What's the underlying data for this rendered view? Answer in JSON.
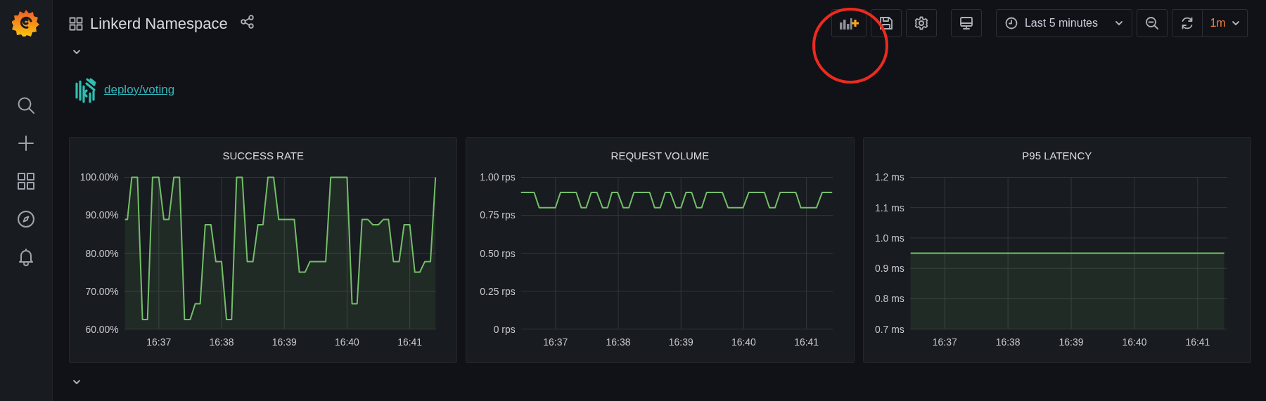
{
  "dashboard": {
    "title": "Linkerd Namespace"
  },
  "toolbar": {
    "time_range": "Last 5 minutes",
    "refresh_interval": "1m"
  },
  "link": {
    "text": "deploy/voting"
  },
  "panels": [
    {
      "chart_data": {
        "type": "area",
        "title": "SUCCESS RATE",
        "x": [
          996.46,
          996.5,
          996.57,
          996.66,
          996.74,
          996.82,
          996.9,
          997,
          997.08,
          997.16,
          997.24,
          997.33,
          997.41,
          997.5,
          997.58,
          997.66,
          997.74,
          997.83,
          997.91,
          998,
          998.08,
          998.16,
          998.24,
          998.33,
          998.41,
          998.5,
          998.58,
          998.66,
          998.74,
          998.83,
          998.91,
          999.16,
          999.24,
          999.33,
          999.41,
          999.66,
          999.74,
          1000,
          1000.08,
          1000.16,
          1000.24,
          1000.33,
          1000.41,
          1000.5,
          1000.58,
          1000.66,
          1000.74,
          1000.83,
          1000.91,
          1001,
          1001.08,
          1001.16,
          1001.24,
          1001.33,
          1001.41
        ],
        "series": [
          {
            "color": "#73bf69",
            "values": [
              88.9,
              88.9,
              100,
              100,
              62.5,
              62.5,
              100,
              100,
              88.9,
              88.9,
              100,
              100,
              62.5,
              62.5,
              66.7,
              66.7,
              87.5,
              87.5,
              77.8,
              77.8,
              62.5,
              62.5,
              100,
              100,
              77.8,
              77.8,
              87.5,
              87.5,
              100,
              100,
              88.9,
              88.9,
              75,
              75,
              77.8,
              77.8,
              100,
              100,
              66.7,
              66.7,
              88.9,
              88.9,
              87.5,
              87.5,
              88.9,
              88.9,
              77.8,
              77.8,
              87.5,
              87.5,
              75,
              75,
              77.8,
              77.8,
              100
            ]
          }
        ],
        "xlim": [
          996.45,
          1001.42
        ],
        "ylim": [
          60,
          100
        ],
        "grid": true,
        "xticks": [
          {
            "value": 997,
            "label": "16:37"
          },
          {
            "value": 998,
            "label": "16:38"
          },
          {
            "value": 999,
            "label": "16:39"
          },
          {
            "value": 1000,
            "label": "16:40"
          },
          {
            "value": 1001,
            "label": "16:41"
          }
        ],
        "yticks": [
          {
            "value": 60,
            "label": "60.00%"
          },
          {
            "value": 70,
            "label": "70.00%"
          },
          {
            "value": 80,
            "label": "80.00%"
          },
          {
            "value": 90,
            "label": "90.00%"
          },
          {
            "value": 100,
            "label": "100.00%"
          }
        ]
      }
    },
    {
      "chart_data": {
        "type": "line",
        "title": "REQUEST VOLUME",
        "x": [
          996.45,
          996.66,
          996.74,
          997,
          997.08,
          997.33,
          997.41,
          997.49,
          997.57,
          997.66,
          997.75,
          997.83,
          997.9,
          997.99,
          998.08,
          998.17,
          998.25,
          998.5,
          998.58,
          998.67,
          998.75,
          998.83,
          998.92,
          999,
          999.08,
          999.17,
          999.25,
          999.33,
          999.41,
          999.66,
          999.75,
          999.99,
          1000.08,
          1000.33,
          1000.41,
          1000.5,
          1000.58,
          1000.83,
          1000.91,
          1001.16,
          1001.25,
          1001.41
        ],
        "series": [
          {
            "color": "#73bf69",
            "values": [
              0.9,
              0.9,
              0.8,
              0.8,
              0.9,
              0.9,
              0.8,
              0.8,
              0.9,
              0.9,
              0.8,
              0.8,
              0.9,
              0.9,
              0.8,
              0.8,
              0.9,
              0.9,
              0.8,
              0.8,
              0.9,
              0.9,
              0.8,
              0.8,
              0.9,
              0.9,
              0.8,
              0.8,
              0.9,
              0.9,
              0.8,
              0.8,
              0.9,
              0.9,
              0.8,
              0.8,
              0.9,
              0.9,
              0.8,
              0.8,
              0.9,
              0.9
            ]
          }
        ],
        "xlim": [
          996.45,
          1001.42
        ],
        "ylim": [
          0,
          1
        ],
        "grid": true,
        "xticks": [
          {
            "value": 997,
            "label": "16:37"
          },
          {
            "value": 998,
            "label": "16:38"
          },
          {
            "value": 999,
            "label": "16:39"
          },
          {
            "value": 1000,
            "label": "16:40"
          },
          {
            "value": 1001,
            "label": "16:41"
          }
        ],
        "yticks": [
          {
            "value": 0,
            "label": "0 rps"
          },
          {
            "value": 0.25,
            "label": "0.25 rps"
          },
          {
            "value": 0.5,
            "label": "0.50 rps"
          },
          {
            "value": 0.75,
            "label": "0.75 rps"
          },
          {
            "value": 1,
            "label": "1.00 rps"
          }
        ]
      }
    },
    {
      "chart_data": {
        "type": "area",
        "title": "P95 LATENCY",
        "x": [
          996.46,
          1001.42
        ],
        "series": [
          {
            "color": "#73bf69",
            "values": [
              0.95,
              0.95
            ]
          }
        ],
        "xlim": [
          996.45,
          1001.47
        ],
        "ylim": [
          0.7,
          1.2
        ],
        "grid": true,
        "xticks": [
          {
            "value": 997,
            "label": "16:37"
          },
          {
            "value": 998,
            "label": "16:38"
          },
          {
            "value": 999,
            "label": "16:39"
          },
          {
            "value": 1000,
            "label": "16:40"
          },
          {
            "value": 1001,
            "label": "16:41"
          }
        ],
        "yticks": [
          {
            "value": 0.7,
            "label": "0.7 ms"
          },
          {
            "value": 0.8,
            "label": "0.8 ms"
          },
          {
            "value": 0.9,
            "label": "0.9 ms"
          },
          {
            "value": 1.0,
            "label": "1.0 ms"
          },
          {
            "value": 1.1,
            "label": "1.1 ms"
          },
          {
            "value": 1.2,
            "label": "1.2 ms"
          }
        ]
      }
    }
  ]
}
